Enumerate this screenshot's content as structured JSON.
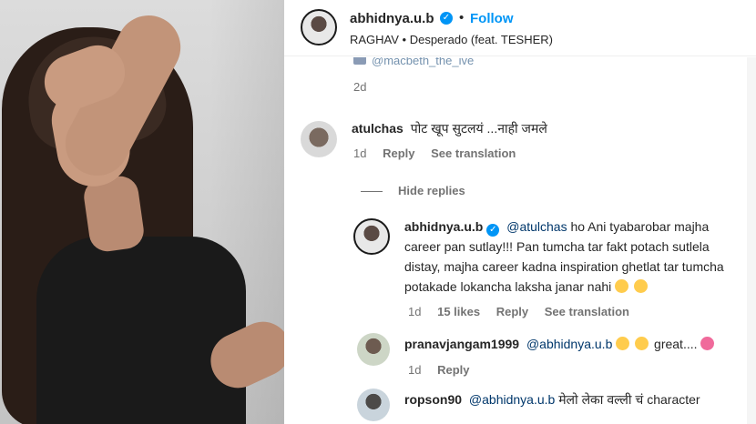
{
  "post": {
    "username": "abhidnya.u.b",
    "verified_glyph": "✓",
    "separator": "•",
    "follow_label": "Follow",
    "audio": "RAGHAV • Desperado (feat. TESHER)"
  },
  "comments": {
    "previous": {
      "partial_text": "@macbeth_the_ive",
      "time": "2d"
    },
    "items": [
      {
        "username": "atulchas",
        "text": "पोट खूप सुटलयं ...नाही जमले",
        "time": "1d",
        "reply_label": "Reply",
        "translation_label": "See translation",
        "hide_replies_label": "Hide replies",
        "replies": [
          {
            "username": "abhidnya.u.b",
            "mention": "@atulchas",
            "text": "ho Ani tyabarobar majha career pan sutlay!!! Pan tumcha tar fakt potach sutlela distay, majha career kadna inspiration ghetlat tar tumcha potakade lokancha laksha janar nahi",
            "time": "1d",
            "likes": "15 likes",
            "reply_label": "Reply",
            "translation_label": "See translation"
          },
          {
            "username": "pranavjangam1999",
            "mention": "@abhidnya.u.b",
            "text": "great....",
            "time": "1d",
            "reply_label": "Reply"
          },
          {
            "username": "ropson90",
            "mention": "@abhidnya.u.b",
            "text": "मेलो लेका वल्ली चं character"
          }
        ]
      }
    ]
  },
  "icons": {
    "verified": "verified-badge-icon",
    "emoji_pensive": "pensive-face-emoji",
    "emoji_laugh": "laughing-face-emoji",
    "emoji_heart_eyes": "heart-eyes-emoji"
  },
  "colors": {
    "accent": "#0095f6",
    "mention": "#00376b",
    "muted": "#737373",
    "text": "#262626"
  }
}
